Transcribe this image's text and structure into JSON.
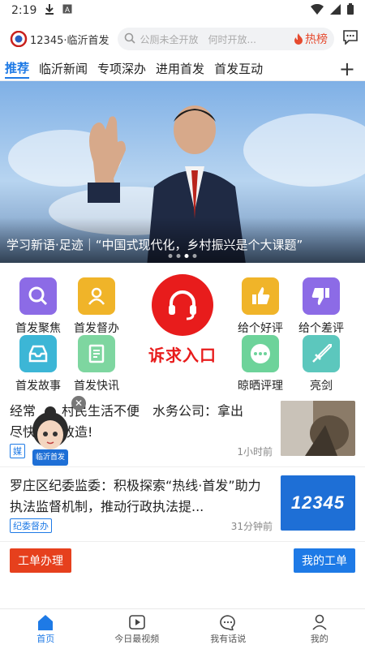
{
  "status": {
    "time": "2:19"
  },
  "header": {
    "logo_text": "12345·临沂首发",
    "search_placeholder": "公厕未全开放　何时开放...",
    "hot_label": "热榜"
  },
  "tabs": [
    "推荐",
    "临沂新闻",
    "专项深办",
    "进用首发",
    "首发互动"
  ],
  "banner": {
    "caption": "学习新语·足迹｜“中国式现代化，乡村振兴是个大课题”"
  },
  "grid": {
    "items": [
      {
        "label": "首发聚焦",
        "icon": "search-icon",
        "color": "#8c6be6"
      },
      {
        "label": "首发督办",
        "icon": "users-icon",
        "color": "#f0b429"
      },
      {
        "label": "给个好评",
        "icon": "thumbs-up-icon",
        "color": "#f0b429"
      },
      {
        "label": "给个差评",
        "icon": "thumbs-down-icon",
        "color": "#8c6be6"
      },
      {
        "label": "首发故事",
        "icon": "inbox-icon",
        "color": "#3cb6d6"
      },
      {
        "label": "首发快讯",
        "icon": "document-icon",
        "color": "#7ed6a0"
      },
      {
        "label": "晾晒评理",
        "icon": "chat-dots-icon",
        "color": "#6dd39a"
      },
      {
        "label": "亮剑",
        "icon": "sword-icon",
        "color": "#5cc7bd"
      }
    ],
    "appeal_label": "诉求入口"
  },
  "news": [
    {
      "title": "经常　　村民生活不便　水务公司：拿出　　尽快提升改造!",
      "tag": "媒",
      "time": "1小时前"
    },
    {
      "title": "罗庄区纪委监委：积极探索“热线·首发”助力执法监督机制，推动行政执法提...",
      "tag": "纪委督办",
      "time": "31分钟前"
    }
  ],
  "float_badge": "临沂首发",
  "work": {
    "left": "工单办理",
    "right": "我的工单"
  },
  "nav": [
    {
      "label": "首页",
      "icon": "home-icon"
    },
    {
      "label": "今日最视频",
      "icon": "video-icon"
    },
    {
      "label": "我有话说",
      "icon": "chat-icon"
    },
    {
      "label": "我的",
      "icon": "user-icon"
    }
  ],
  "thumb2_text": "12345"
}
